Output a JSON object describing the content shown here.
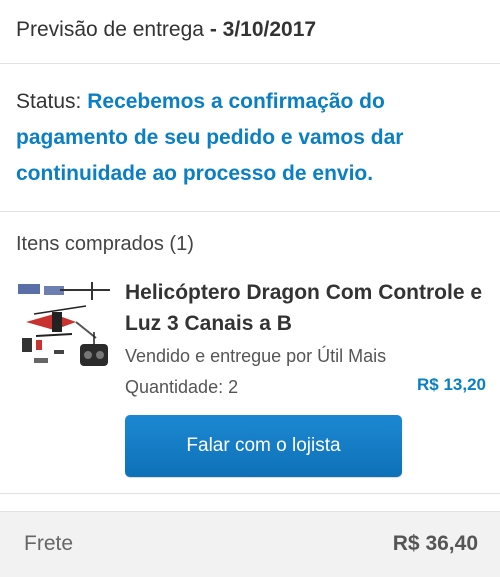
{
  "delivery": {
    "label": "Previsão de entrega",
    "date": "- 3/10/2017"
  },
  "status": {
    "label": "Status:",
    "text": "Recebemos a confirmação do pagamento de seu pedido e vamos dar continuidade ao processo de envio."
  },
  "items": {
    "heading": "Itens comprados (1)",
    "list": [
      {
        "image_icon": "helicopter-product-image",
        "title": "Helicóptero Dragon Com Controle e Luz 3 Canais a B",
        "seller": "Vendido e entregue por Útil Mais",
        "quantity": "Quantidade: 2",
        "price": "R$ 13,20"
      }
    ]
  },
  "actions": {
    "contact_seller": "Falar com o lojista"
  },
  "shipping": {
    "label": "Frete",
    "value": "R$ 36,40"
  },
  "colors": {
    "accent": "#0a7fc4",
    "button": "#1379c0",
    "text": "#333333",
    "footer_bg": "#f2f2f2"
  }
}
